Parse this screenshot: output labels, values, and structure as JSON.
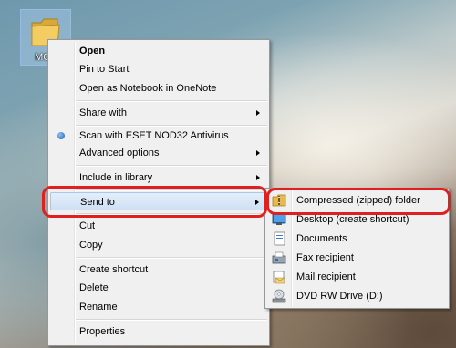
{
  "desktop": {
    "folder_label": "MCT"
  },
  "context_menu": {
    "open": "Open",
    "pin_to_start": "Pin to Start",
    "open_onenote": "Open as Notebook in OneNote",
    "share_with": "Share with",
    "scan_eset": "Scan with ESET NOD32 Antivirus",
    "advanced_options": "Advanced options",
    "include_in_library": "Include in library",
    "send_to": "Send to",
    "cut": "Cut",
    "copy": "Copy",
    "create_shortcut": "Create shortcut",
    "delete": "Delete",
    "rename": "Rename",
    "properties": "Properties"
  },
  "send_to_menu": {
    "items": [
      {
        "label": "Compressed (zipped) folder",
        "icon": "zip-folder-icon"
      },
      {
        "label": "Desktop (create shortcut)",
        "icon": "desktop-icon"
      },
      {
        "label": "Documents",
        "icon": "documents-icon"
      },
      {
        "label": "Fax recipient",
        "icon": "fax-icon"
      },
      {
        "label": "Mail recipient",
        "icon": "mail-icon"
      },
      {
        "label": "DVD RW Drive (D:)",
        "icon": "dvd-drive-icon"
      }
    ]
  },
  "colors": {
    "highlight_annotation": "#e02020",
    "menu_background": "#f0f0f0",
    "hover_background": "#cfe0f5"
  }
}
